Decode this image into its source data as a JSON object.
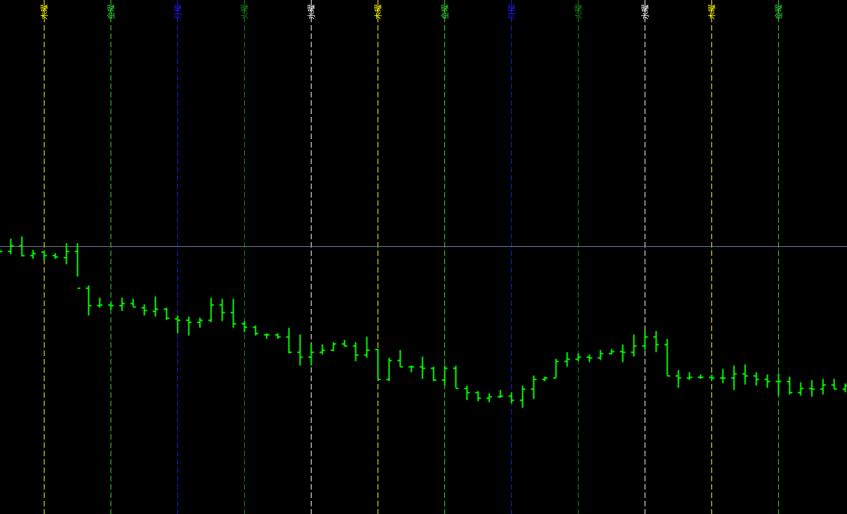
{
  "colors": {
    "background": "#000000",
    "bar": "#00ff00",
    "current_price_line": "#6f7f97"
  },
  "chart_data": {
    "type": "ohlc",
    "grid": false,
    "legend": "none",
    "x_units": "bar index (one bar per hour, leftmost visible bar = 0)",
    "y_units": "price (scale not printed)",
    "ylim": [
      0,
      100
    ],
    "current_price": 50.5,
    "day_separators": [
      {
        "label": "木曜",
        "x": 4,
        "color": "#ffff00"
      },
      {
        "label": "金曜",
        "x": 10,
        "color": "#31d431"
      },
      {
        "label": "月曜",
        "x": 16,
        "color": "#1b1be6"
      },
      {
        "label": "火曜",
        "x": 22,
        "color": "#128a12"
      },
      {
        "label": "水曜",
        "x": 28,
        "color": "#ffffff"
      },
      {
        "label": "木曜",
        "x": 34,
        "color": "#ffff00"
      },
      {
        "label": "金曜",
        "x": 40,
        "color": "#31d431"
      },
      {
        "label": "月曜",
        "x": 46,
        "color": "#1b1be6"
      },
      {
        "label": "火曜",
        "x": 52,
        "color": "#128a12"
      },
      {
        "label": "水曜",
        "x": 58,
        "color": "#ffffff"
      },
      {
        "label": "木曜",
        "x": 64,
        "color": "#ffff00"
      },
      {
        "label": "金曜",
        "x": 70,
        "color": "#31d431"
      }
    ],
    "bars": [
      {
        "o": 48.5,
        "h": 49.0,
        "l": 48.0,
        "c": 48.5
      },
      {
        "o": 48.5,
        "h": 54.0,
        "l": 47.0,
        "c": 51.0
      },
      {
        "o": 51.0,
        "h": 55.0,
        "l": 46.0,
        "c": 46.5
      },
      {
        "o": 46.5,
        "h": 49.0,
        "l": 45.0,
        "c": 47.5
      },
      {
        "o": 48.0,
        "h": 48.5,
        "l": 44.5,
        "c": 46.5
      },
      {
        "o": 46.5,
        "h": 47.5,
        "l": 45.0,
        "c": 46.0
      },
      {
        "o": 45.5,
        "h": 52.0,
        "l": 42.5,
        "c": 48.5
      },
      {
        "o": 48.5,
        "h": 52.0,
        "l": 37.0,
        "c": 32.0
      },
      {
        "o": 32.0,
        "h": 33.0,
        "l": 19.5,
        "c": 24.0
      },
      {
        "o": 24.0,
        "h": 27.5,
        "l": 23.0,
        "c": 24.5
      },
      {
        "o": 24.5,
        "h": 25.5,
        "l": 22.0,
        "c": 24.0
      },
      {
        "o": 24.0,
        "h": 27.5,
        "l": 21.5,
        "c": 25.0
      },
      {
        "o": 25.0,
        "h": 27.0,
        "l": 23.5,
        "c": 23.5
      },
      {
        "o": 23.0,
        "h": 24.5,
        "l": 19.5,
        "c": 22.0
      },
      {
        "o": 21.5,
        "h": 28.0,
        "l": 19.0,
        "c": 22.5
      },
      {
        "o": 22.5,
        "h": 23.0,
        "l": 17.5,
        "c": 18.5
      },
      {
        "o": 18.0,
        "h": 19.5,
        "l": 11.5,
        "c": 17.5
      },
      {
        "o": 17.5,
        "h": 19.0,
        "l": 10.5,
        "c": 16.5
      },
      {
        "o": 16.5,
        "h": 18.5,
        "l": 14.0,
        "c": 17.5
      },
      {
        "o": 17.5,
        "h": 27.5,
        "l": 16.5,
        "c": 24.5
      },
      {
        "o": 24.5,
        "h": 27.0,
        "l": 17.0,
        "c": 21.0
      },
      {
        "o": 21.0,
        "h": 27.0,
        "l": 14.0,
        "c": 16.0
      },
      {
        "o": 16.0,
        "h": 17.0,
        "l": 12.0,
        "c": 14.5
      },
      {
        "o": 14.5,
        "h": 15.0,
        "l": 10.5,
        "c": 11.5
      },
      {
        "o": 11.0,
        "h": 11.5,
        "l": 9.0,
        "c": 11.0
      },
      {
        "o": 11.0,
        "h": 11.5,
        "l": 9.0,
        "c": 10.0
      },
      {
        "o": 10.0,
        "h": 14.0,
        "l": 2.5,
        "c": 3.0
      },
      {
        "o": 3.0,
        "h": 11.0,
        "l": -3.0,
        "c": 1.0
      },
      {
        "o": 1.0,
        "h": 7.0,
        "l": -3.0,
        "c": 3.0
      },
      {
        "o": 3.0,
        "h": 6.5,
        "l": 2.0,
        "c": 4.0
      },
      {
        "o": 4.0,
        "h": 7.5,
        "l": 3.5,
        "c": 7.0
      },
      {
        "o": 7.0,
        "h": 8.5,
        "l": 5.5,
        "c": 6.0
      },
      {
        "o": 6.0,
        "h": 7.5,
        "l": -1.0,
        "c": 2.0
      },
      {
        "o": 2.0,
        "h": 10.0,
        "l": 0.5,
        "c": 4.0
      }
    ],
    "bars_continued": [
      {
        "o": 4.5,
        "h": 4.5,
        "l": -9.0,
        "c": -9.0
      },
      {
        "o": -9.0,
        "h": 0.5,
        "l": -10.0,
        "c": -0.5
      },
      {
        "o": -0.5,
        "h": 4.0,
        "l": -3.5,
        "c": -3.5
      },
      {
        "o": -3.5,
        "h": -3.0,
        "l": -6.0,
        "c": -3.5
      },
      {
        "o": -3.5,
        "h": 1.0,
        "l": -9.0,
        "c": -4.0
      },
      {
        "o": -4.0,
        "h": -3.5,
        "l": -10.0,
        "c": -9.5
      },
      {
        "o": -9.5,
        "h": -3.0,
        "l": -12.0,
        "c": -4.0
      },
      {
        "o": -4.0,
        "h": -3.0,
        "l": -13.0,
        "c": -13.0
      },
      {
        "o": -13.0,
        "h": -12.0,
        "l": -18.5,
        "c": -15.0
      },
      {
        "o": -15.0,
        "h": -14.5,
        "l": -19.0,
        "c": -17.5
      },
      {
        "o": -17.5,
        "h": -15.5,
        "l": -19.5,
        "c": -17.0
      },
      {
        "o": -17.0,
        "h": -14.0,
        "l": -17.5,
        "c": -16.5
      },
      {
        "o": -16.5,
        "h": -15.0,
        "l": -20.0,
        "c": -18.5
      },
      {
        "o": -18.5,
        "h": -12.0,
        "l": -22.0,
        "c": -13.5
      },
      {
        "o": -13.5,
        "h": -7.5,
        "l": -18.0,
        "c": -9.0
      },
      {
        "o": -9.0,
        "h": -8.0,
        "l": -10.0,
        "c": -8.5
      },
      {
        "o": -8.5,
        "h": 0.0,
        "l": -8.5,
        "c": -1.0
      },
      {
        "o": -1.0,
        "h": 3.0,
        "l": -3.5,
        "c": 0.0
      },
      {
        "o": 0.0,
        "h": 2.5,
        "l": -1.0,
        "c": 1.0
      },
      {
        "o": 1.0,
        "h": 2.0,
        "l": -1.5,
        "c": 0.5
      },
      {
        "o": 0.5,
        "h": 4.0,
        "l": -0.5,
        "c": 2.5
      },
      {
        "o": 2.5,
        "h": 4.5,
        "l": 2.0,
        "c": 3.5
      },
      {
        "o": 3.5,
        "h": 6.5,
        "l": -1.5,
        "c": 3.0
      },
      {
        "o": 3.0,
        "h": 11.0,
        "l": 1.0,
        "c": 6.0
      },
      {
        "o": 6.0,
        "h": 13.0,
        "l": 4.0,
        "c": 10.0
      },
      {
        "o": 10.0,
        "h": 12.5,
        "l": 3.0,
        "c": 6.5
      },
      {
        "o": 6.5,
        "h": 9.0,
        "l": -7.5,
        "c": -7.5
      },
      {
        "o": -7.5,
        "h": -5.0,
        "l": -13.0,
        "c": -8.5
      },
      {
        "o": -8.5,
        "h": -6.0,
        "l": -9.5,
        "c": -8.0
      },
      {
        "o": -8.0,
        "h": -7.0,
        "l": -9.0,
        "c": -8.0
      },
      {
        "o": -8.0,
        "h": -7.0,
        "l": -9.5,
        "c": -8.5
      },
      {
        "o": -8.5,
        "h": -4.5,
        "l": -11.0,
        "c": -8.5
      },
      {
        "o": -8.5,
        "h": -3.0,
        "l": -14.0,
        "c": -6.5
      },
      {
        "o": -6.5,
        "h": -2.5,
        "l": -11.5,
        "c": -7.5
      },
      {
        "o": -7.5,
        "h": -6.0,
        "l": -12.0,
        "c": -9.0
      },
      {
        "o": -9.0,
        "h": -7.0,
        "l": -13.0,
        "c": -10.0
      },
      {
        "o": -10.0,
        "h": -6.5,
        "l": -16.5,
        "c": -10.0
      },
      {
        "o": -10.0,
        "h": -8.0,
        "l": -16.0,
        "c": -15.0
      },
      {
        "o": -15.0,
        "h": -10.5,
        "l": -16.5,
        "c": -13.0
      },
      {
        "o": -13.0,
        "h": -9.5,
        "l": -17.0,
        "c": -13.5
      },
      {
        "o": -13.5,
        "h": -9.0,
        "l": -16.0,
        "c": -11.5
      },
      {
        "o": -11.5,
        "h": -9.0,
        "l": -13.5,
        "c": -13.5
      },
      {
        "o": -13.5,
        "h": -11.0,
        "l": -15.0,
        "c": -12.0
      },
      {
        "o": -12.0,
        "h": 1.0,
        "l": -13.0,
        "c": 0.5
      },
      {
        "o": 0.5,
        "h": 8.0,
        "l": -3.0,
        "c": 0.5
      }
    ]
  }
}
